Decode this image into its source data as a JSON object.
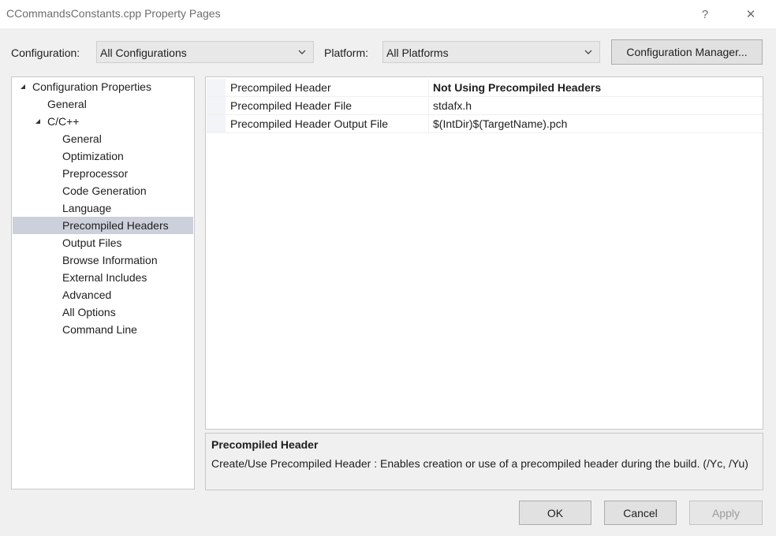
{
  "window": {
    "title": "CCommandsConstants.cpp Property Pages",
    "help_glyph": "?",
    "close_glyph": "✕"
  },
  "toolbar": {
    "configuration_label": "Configuration:",
    "configuration_value": "All Configurations",
    "platform_label": "Platform:",
    "platform_value": "All Platforms",
    "config_manager_label": "Configuration Manager..."
  },
  "tree": {
    "items": [
      {
        "label": "Configuration Properties",
        "expanded": true
      },
      {
        "label": "General"
      },
      {
        "label": "C/C++",
        "expanded": true
      },
      {
        "label": "General"
      },
      {
        "label": "Optimization"
      },
      {
        "label": "Preprocessor"
      },
      {
        "label": "Code Generation"
      },
      {
        "label": "Language"
      },
      {
        "label": "Precompiled Headers",
        "selected": true
      },
      {
        "label": "Output Files"
      },
      {
        "label": "Browse Information"
      },
      {
        "label": "External Includes"
      },
      {
        "label": "Advanced"
      },
      {
        "label": "All Options"
      },
      {
        "label": "Command Line"
      }
    ]
  },
  "properties": {
    "rows": [
      {
        "name": "Precompiled Header",
        "value": "Not Using Precompiled Headers",
        "bold": true
      },
      {
        "name": "Precompiled Header File",
        "value": "stdafx.h"
      },
      {
        "name": "Precompiled Header Output File",
        "value": "$(IntDir)$(TargetName).pch"
      }
    ]
  },
  "description": {
    "title": "Precompiled Header",
    "text": "Create/Use Precompiled Header : Enables creation or use of a precompiled header during the build. (/Yc, /Yu)"
  },
  "buttons": {
    "ok": "OK",
    "cancel": "Cancel",
    "apply": "Apply"
  },
  "colors": {
    "selection": "#ccd0db",
    "window_bg": "#f0f0f0"
  }
}
